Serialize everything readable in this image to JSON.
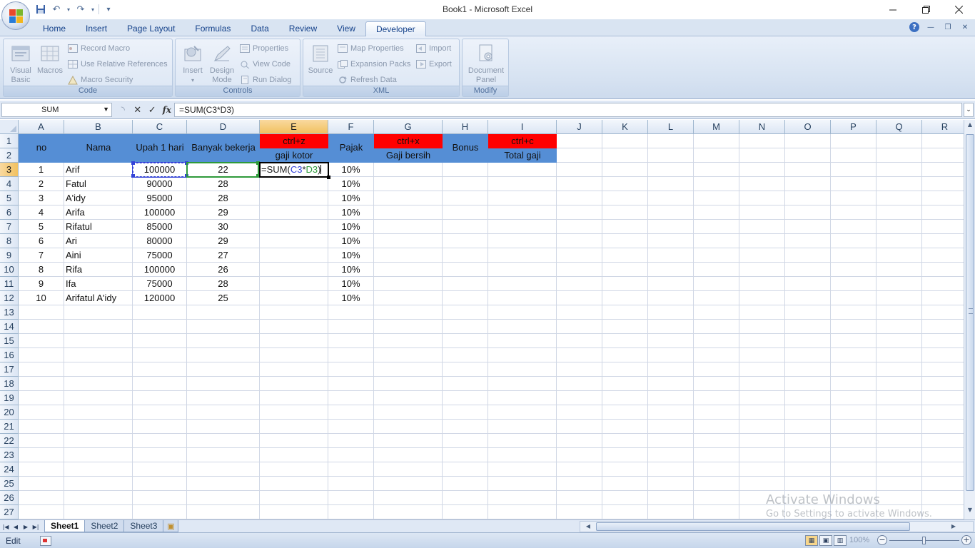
{
  "window": {
    "title": "Book1 - Microsoft Excel"
  },
  "quick_access": {
    "undo": "↶",
    "redo": "↷",
    "customize": "▾"
  },
  "ribbon": {
    "tabs": [
      {
        "label": "Home"
      },
      {
        "label": "Insert"
      },
      {
        "label": "Page Layout"
      },
      {
        "label": "Formulas"
      },
      {
        "label": "Data"
      },
      {
        "label": "Review"
      },
      {
        "label": "View"
      },
      {
        "label": "Developer",
        "active": true
      }
    ],
    "groups": {
      "code": {
        "label": "Code",
        "visual_basic": "Visual\nBasic",
        "macros": "Macros",
        "record_macro": "Record Macro",
        "use_relative": "Use Relative References",
        "macro_security": "Macro Security"
      },
      "controls": {
        "label": "Controls",
        "insert": "Insert",
        "design_mode": "Design\nMode",
        "properties": "Properties",
        "view_code": "View Code",
        "run_dialog": "Run Dialog"
      },
      "xml": {
        "label": "XML",
        "source": "Source",
        "map_properties": "Map Properties",
        "expansion_packs": "Expansion Packs",
        "refresh_data": "Refresh Data",
        "import": "Import",
        "export": "Export"
      },
      "modify": {
        "label": "Modify",
        "document_panel": "Document\nPanel"
      }
    }
  },
  "formula_bar": {
    "name_box": "SUM",
    "fx": "fx",
    "formula": "=SUM(C3*D3)"
  },
  "columns": [
    "A",
    "B",
    "C",
    "D",
    "E",
    "F",
    "G",
    "H",
    "I",
    "J",
    "K",
    "L",
    "M",
    "N",
    "O",
    "P",
    "Q",
    "R"
  ],
  "rows": [
    "1",
    "2",
    "3",
    "4",
    "5",
    "6",
    "7",
    "8",
    "9",
    "10",
    "11",
    "12",
    "13",
    "14",
    "15",
    "16",
    "17",
    "18",
    "19",
    "20",
    "21",
    "22",
    "23",
    "24",
    "25",
    "26",
    "27"
  ],
  "header": {
    "no": "no",
    "nama": "Nama",
    "upah": "Upah 1 hari",
    "banyak": "Banyak bekerja",
    "e1": "ctrl+z",
    "e2": "gaji kotor",
    "pajak": "Pajak",
    "g1": "ctrl+x",
    "g2": "Gaji bersih",
    "bonus": "Bonus",
    "i1": "ctrl+c",
    "i2": "Total gaji"
  },
  "table": [
    {
      "no": "1",
      "nama": "Arif",
      "upah": "100000",
      "banyak": "22",
      "pajak": "10%"
    },
    {
      "no": "2",
      "nama": "Fatul",
      "upah": "90000",
      "banyak": "28",
      "pajak": "10%"
    },
    {
      "no": "3",
      "nama": "A'idy",
      "upah": "95000",
      "banyak": "28",
      "pajak": "10%"
    },
    {
      "no": "4",
      "nama": "Arifa",
      "upah": "100000",
      "banyak": "29",
      "pajak": "10%"
    },
    {
      "no": "5",
      "nama": "Rifatul",
      "upah": "85000",
      "banyak": "30",
      "pajak": "10%"
    },
    {
      "no": "6",
      "nama": "Ari",
      "upah": "80000",
      "banyak": "29",
      "pajak": "10%"
    },
    {
      "no": "7",
      "nama": "Aini",
      "upah": "75000",
      "banyak": "27",
      "pajak": "10%"
    },
    {
      "no": "8",
      "nama": "Rifa",
      "upah": "100000",
      "banyak": "26",
      "pajak": "10%"
    },
    {
      "no": "9",
      "nama": "Ifa",
      "upah": "75000",
      "banyak": "28",
      "pajak": "10%"
    },
    {
      "no": "10",
      "nama": "Arifatul A'idy",
      "upah": "120000",
      "banyak": "25",
      "pajak": "10%"
    }
  ],
  "edit_cell": {
    "prefix": "=SUM(",
    "ref1": "C3",
    "op": "*",
    "ref2": "D3",
    "suffix": ")",
    "ref1_color": "#3342d8",
    "ref2_color": "#2e9a3a"
  },
  "sheets": [
    {
      "label": "Sheet1",
      "active": true
    },
    {
      "label": "Sheet2"
    },
    {
      "label": "Sheet3"
    }
  ],
  "status": {
    "mode": "Edit",
    "zoom": "100%"
  },
  "watermark": {
    "title": "Activate Windows",
    "subtitle": "Go to Settings to activate Windows."
  },
  "colors": {
    "header_blue": "#558ed5",
    "header_red": "#ff0000",
    "selection_orange": "#f1c15f"
  }
}
